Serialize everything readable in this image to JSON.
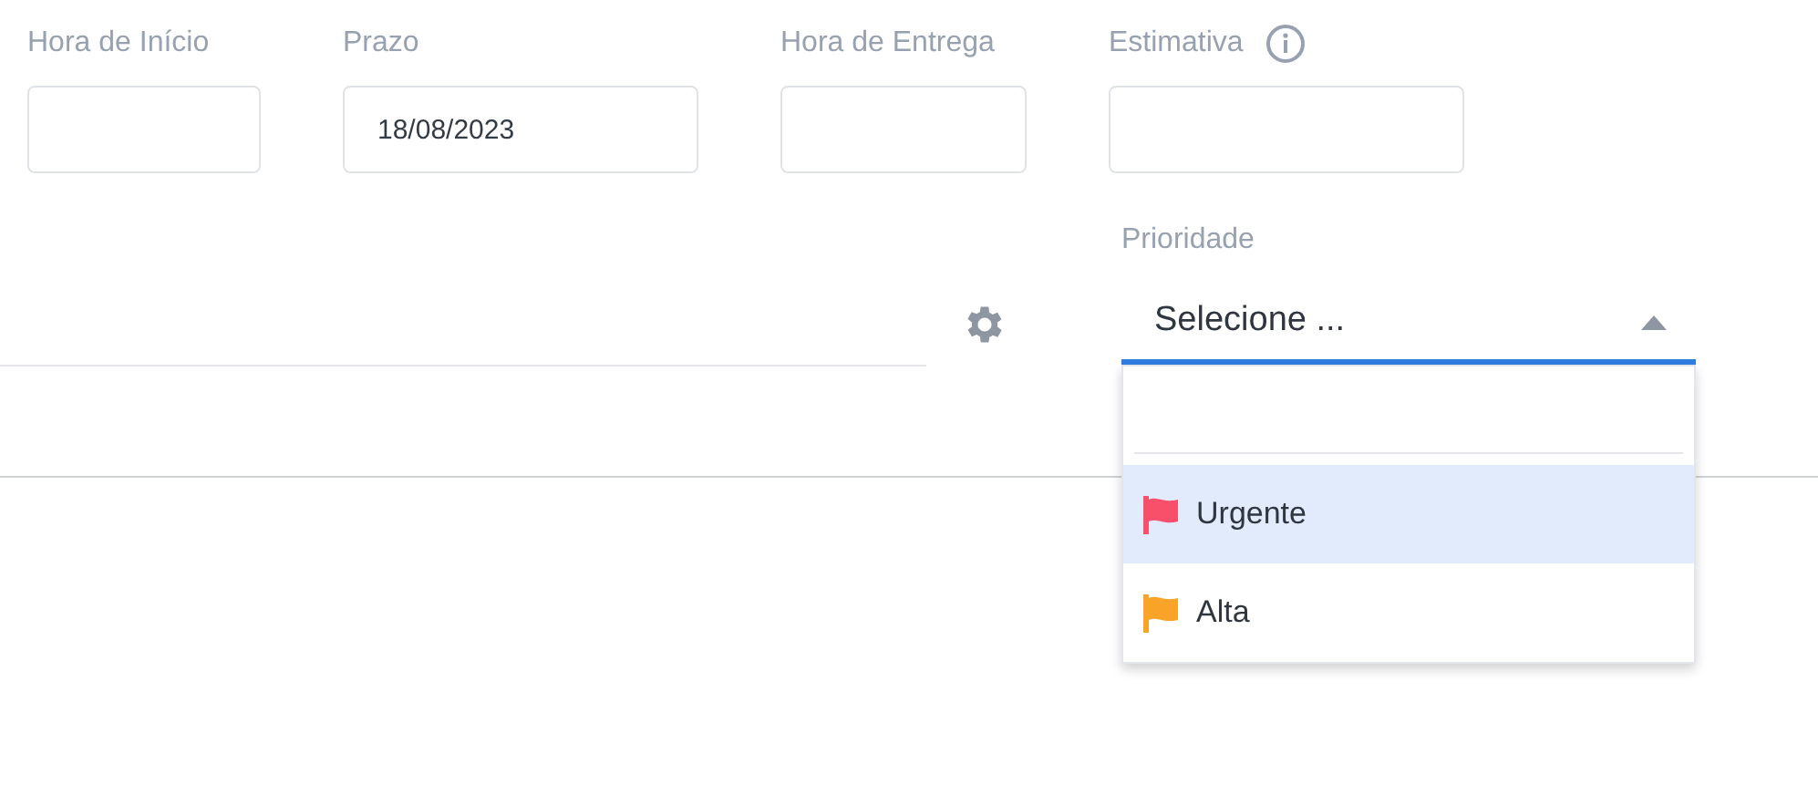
{
  "fields": [
    {
      "label": "Hora de Início"
    },
    {
      "label": "Prazo",
      "value": "18/08/2023"
    },
    {
      "label": "Hora de Entrega"
    },
    {
      "label": "Estimativa",
      "has_info": true
    }
  ],
  "priority": {
    "label": "Prioridade",
    "placeholder": "Selecione ...",
    "expanded": true,
    "options": [
      {
        "label": "Urgente",
        "color": "#f8506a",
        "selected": true
      },
      {
        "label": "Alta",
        "color": "#f9a328",
        "selected": false
      }
    ]
  }
}
